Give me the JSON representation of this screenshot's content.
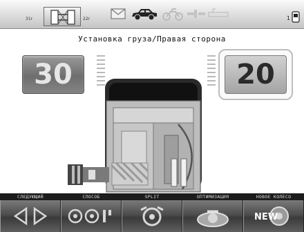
{
  "status_bar": {
    "rim_left": "31r",
    "rim_right": "22r",
    "icons": [
      "tire-rim-icon",
      "envelope-icon",
      "car-icon",
      "motorcycle-icon",
      "truck-icon",
      "ruler-icon",
      "user-icon"
    ],
    "user_count": "1"
  },
  "title": "Установка груза/Правая сторона",
  "left_value": "30",
  "right_value": "20",
  "bottom_labels": [
    "СЛЕДУЮЩИЙ",
    "СПОСОБ",
    "SPLIT",
    "ОПТИМИЗАЦИЯ",
    "НОВОЕ КОЛЕСО"
  ],
  "bottom_buttons": [
    "prev-next-arrows-icon",
    "mode-icon",
    "split-icon",
    "optimization-icon",
    "new-wheel-icon"
  ],
  "new_button_text": "NEW",
  "colors": {
    "left_box": "#6e6e6e",
    "right_box": "#a4a4a4",
    "bar": "#1c1c1c"
  }
}
